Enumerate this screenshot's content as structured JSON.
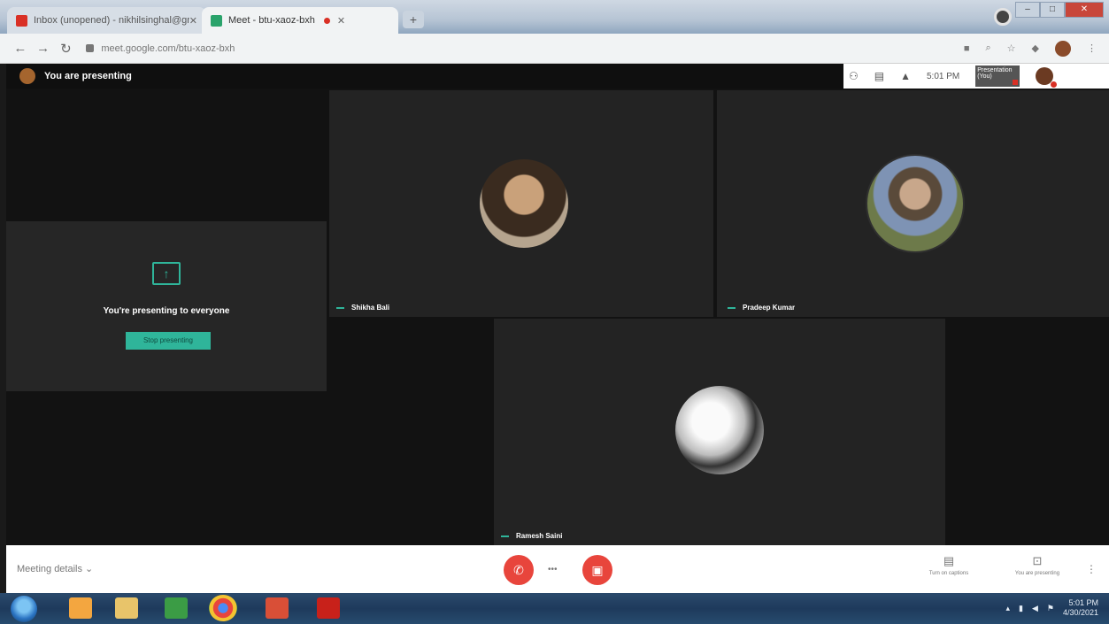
{
  "browser": {
    "tabs": [
      {
        "label": "Inbox (unopened) - nikhilsinghal@gmail.com",
        "active": false
      },
      {
        "label": "Meet - btu-xaoz-bxh",
        "active": true
      }
    ],
    "new_tab": "+",
    "window_controls": {
      "minimize": "–",
      "maximize": "□",
      "close": "✕"
    },
    "url": "meet.google.com/btu-xaoz-bxh"
  },
  "meet": {
    "presenting_label": "You are presenting",
    "top_time": "5:01 PM",
    "preview_label": "Presentation (You)",
    "presenting_message": "You're presenting to everyone",
    "stop_presenting": "Stop presenting",
    "participants": [
      {
        "name": "Shikha Bali"
      },
      {
        "name": "Pradeep Kumar"
      },
      {
        "name": "Ramesh Saini"
      }
    ]
  },
  "controls": {
    "meeting_details": "Meeting details ⌄",
    "call_separator": "•••",
    "captions": "Turn on captions",
    "present_now": "You are presenting",
    "more": "⋮"
  },
  "taskbar": {
    "time": "5:01 PM",
    "date": "4/30/2021"
  },
  "colors": {
    "accent": "#2fb59a",
    "danger": "#e8453c",
    "meet_bg": "#121212",
    "tile_bg": "#232323"
  }
}
